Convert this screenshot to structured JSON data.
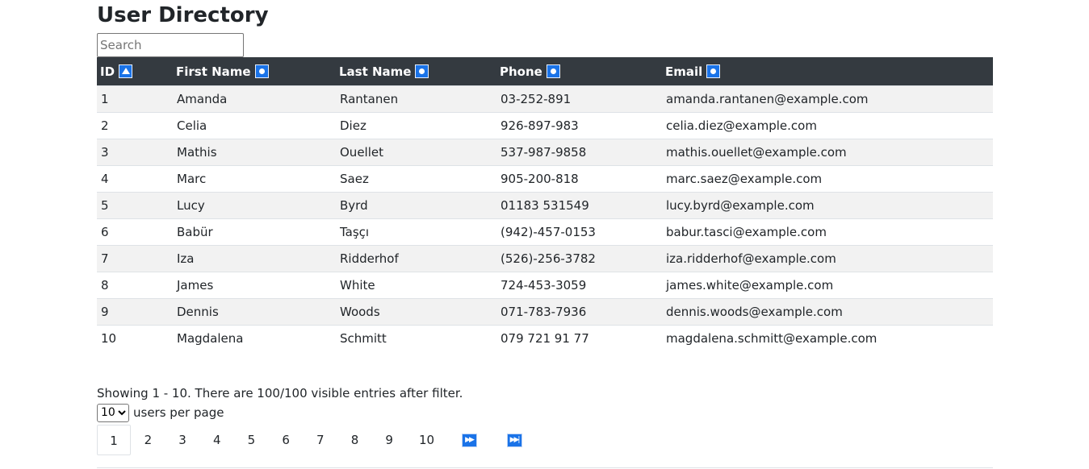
{
  "page": {
    "title": "User Directory"
  },
  "search": {
    "placeholder": "Search",
    "value": ""
  },
  "table": {
    "columns": [
      {
        "label": "ID",
        "sort": "ascending",
        "icon": "sort-ascending-icon"
      },
      {
        "label": "First Name",
        "sort": "none",
        "icon": "sort-neutral-icon"
      },
      {
        "label": "Last Name",
        "sort": "none",
        "icon": "sort-neutral-icon"
      },
      {
        "label": "Phone",
        "sort": "none",
        "icon": "sort-neutral-icon"
      },
      {
        "label": "Email",
        "sort": "none",
        "icon": "sort-neutral-icon"
      }
    ],
    "rows": [
      {
        "id": "1",
        "first": "Amanda",
        "last": "Rantanen",
        "phone": "03-252-891",
        "email": "amanda.rantanen@example.com"
      },
      {
        "id": "2",
        "first": "Celia",
        "last": "Diez",
        "phone": "926-897-983",
        "email": "celia.diez@example.com"
      },
      {
        "id": "3",
        "first": "Mathis",
        "last": "Ouellet",
        "phone": "537-987-9858",
        "email": "mathis.ouellet@example.com"
      },
      {
        "id": "4",
        "first": "Marc",
        "last": "Saez",
        "phone": "905-200-818",
        "email": "marc.saez@example.com"
      },
      {
        "id": "5",
        "first": "Lucy",
        "last": "Byrd",
        "phone": "01183 531549",
        "email": "lucy.byrd@example.com"
      },
      {
        "id": "6",
        "first": "Babür",
        "last": "Taşçı",
        "phone": "(942)-457-0153",
        "email": "babur.tasci@example.com"
      },
      {
        "id": "7",
        "first": "Iza",
        "last": "Ridderhof",
        "phone": "(526)-256-3782",
        "email": "iza.ridderhof@example.com"
      },
      {
        "id": "8",
        "first": "James",
        "last": "White",
        "phone": "724-453-3059",
        "email": "james.white@example.com"
      },
      {
        "id": "9",
        "first": "Dennis",
        "last": "Woods",
        "phone": "071-783-7936",
        "email": "dennis.woods@example.com"
      },
      {
        "id": "10",
        "first": "Magdalena",
        "last": "Schmitt",
        "phone": "079 721 91 77",
        "email": "magdalena.schmitt@example.com"
      }
    ]
  },
  "status": {
    "text": "Showing 1 - 10. There are 100/100 visible entries after filter."
  },
  "per_page": {
    "selected": "10",
    "label": "users per page"
  },
  "pagination": {
    "current": "1",
    "pages": [
      "1",
      "2",
      "3",
      "4",
      "5",
      "6",
      "7",
      "8",
      "9",
      "10"
    ],
    "next_icon": "fast-forward-icon",
    "last_icon": "skip-to-end-icon"
  },
  "colors": {
    "header_bg": "#343a40",
    "stripe_bg": "#f2f2f2",
    "accent": "#1a73e8"
  }
}
